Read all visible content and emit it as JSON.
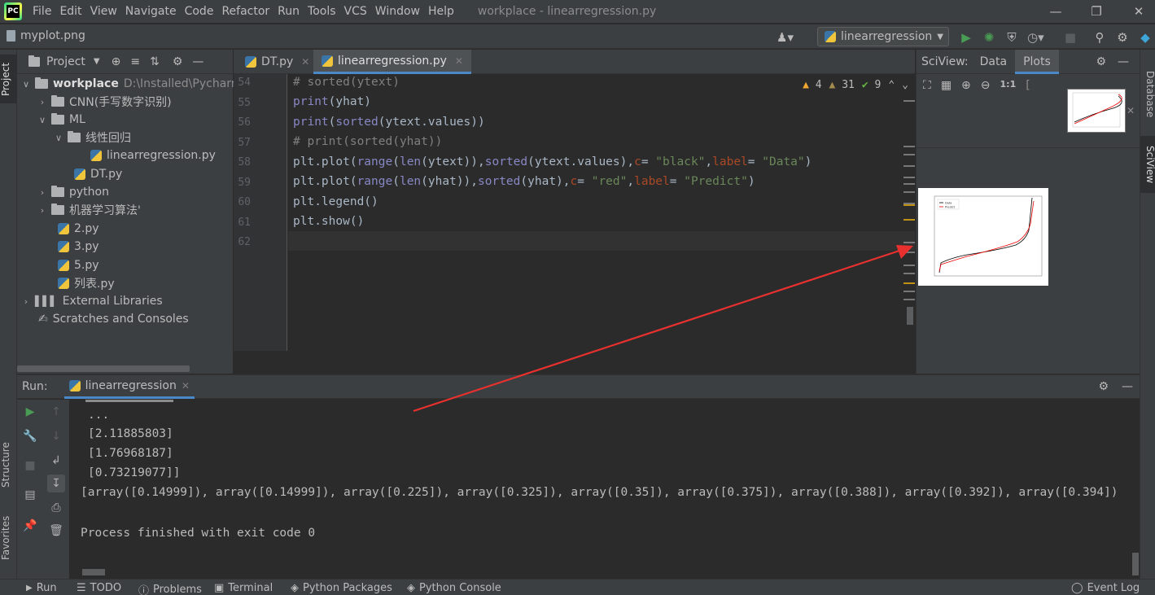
{
  "menubar": {
    "items": [
      "File",
      "Edit",
      "View",
      "Navigate",
      "Code",
      "Refactor",
      "Run",
      "Tools",
      "VCS",
      "Window",
      "Help"
    ],
    "mnemonics": [
      "F",
      "E",
      "V",
      "N",
      "C",
      "R",
      "R",
      "T",
      "S",
      "W",
      "H"
    ],
    "title": "workplace - linearregression.py",
    "logo": "PC"
  },
  "navbar": {
    "file": "myplot.png",
    "run_config": "linearregression"
  },
  "project": {
    "title": "Project",
    "tree": [
      {
        "label": "workplace",
        "extra": "D:\\Installed\\Pycharm\\w"
      },
      {
        "label": "CNN(手写数字识别)"
      },
      {
        "label": "ML"
      },
      {
        "label": "线性回归"
      },
      {
        "label": "linearregression.py"
      },
      {
        "label": "DT.py"
      },
      {
        "label": "python"
      },
      {
        "label": "机器学习算法'"
      },
      {
        "label": "2.py"
      },
      {
        "label": "3.py"
      },
      {
        "label": "5.py"
      },
      {
        "label": "列表.py"
      },
      {
        "label": "External Libraries"
      },
      {
        "label": "Scratches and Consoles"
      }
    ]
  },
  "editor": {
    "tabs": [
      "DT.py",
      "linearregression.py"
    ],
    "line_numbers": [
      "54",
      "55",
      "56",
      "57",
      "58",
      "59",
      "60",
      "61",
      "62"
    ],
    "inspection": {
      "warnings": "4",
      "weak": "31",
      "ok": "9"
    }
  },
  "sciview": {
    "label": "SciView:",
    "tabs": [
      "Data",
      "Plots"
    ],
    "zoom_label": "1:1",
    "legend": [
      "Data",
      "Predict"
    ],
    "colors": {
      "data": "#000000",
      "predict": "#ff0000"
    }
  },
  "right_strip": {
    "tabs": [
      "Database",
      "SciView"
    ]
  },
  "left_strip": {
    "tabs": [
      "Project",
      "Structure",
      "Favorites"
    ]
  },
  "run": {
    "label": "Run:",
    "tab": "linearregression",
    "lines": [
      "...",
      "[2.11885803]",
      "[1.76968187]",
      "[0.73219077]]",
      "[array([0.14999]), array([0.14999]), array([0.225]), array([0.325]), array([0.35]), array([0.375]), array([0.388]), array([0.392]), array([0.394])",
      "",
      "Process finished with exit code 0"
    ]
  },
  "statusbar": {
    "items": [
      "Run",
      "TODO",
      "Problems",
      "Terminal",
      "Python Packages",
      "Python Console"
    ],
    "right": "Event Log"
  },
  "annotation": {
    "arrow_color": "#e8312f"
  }
}
